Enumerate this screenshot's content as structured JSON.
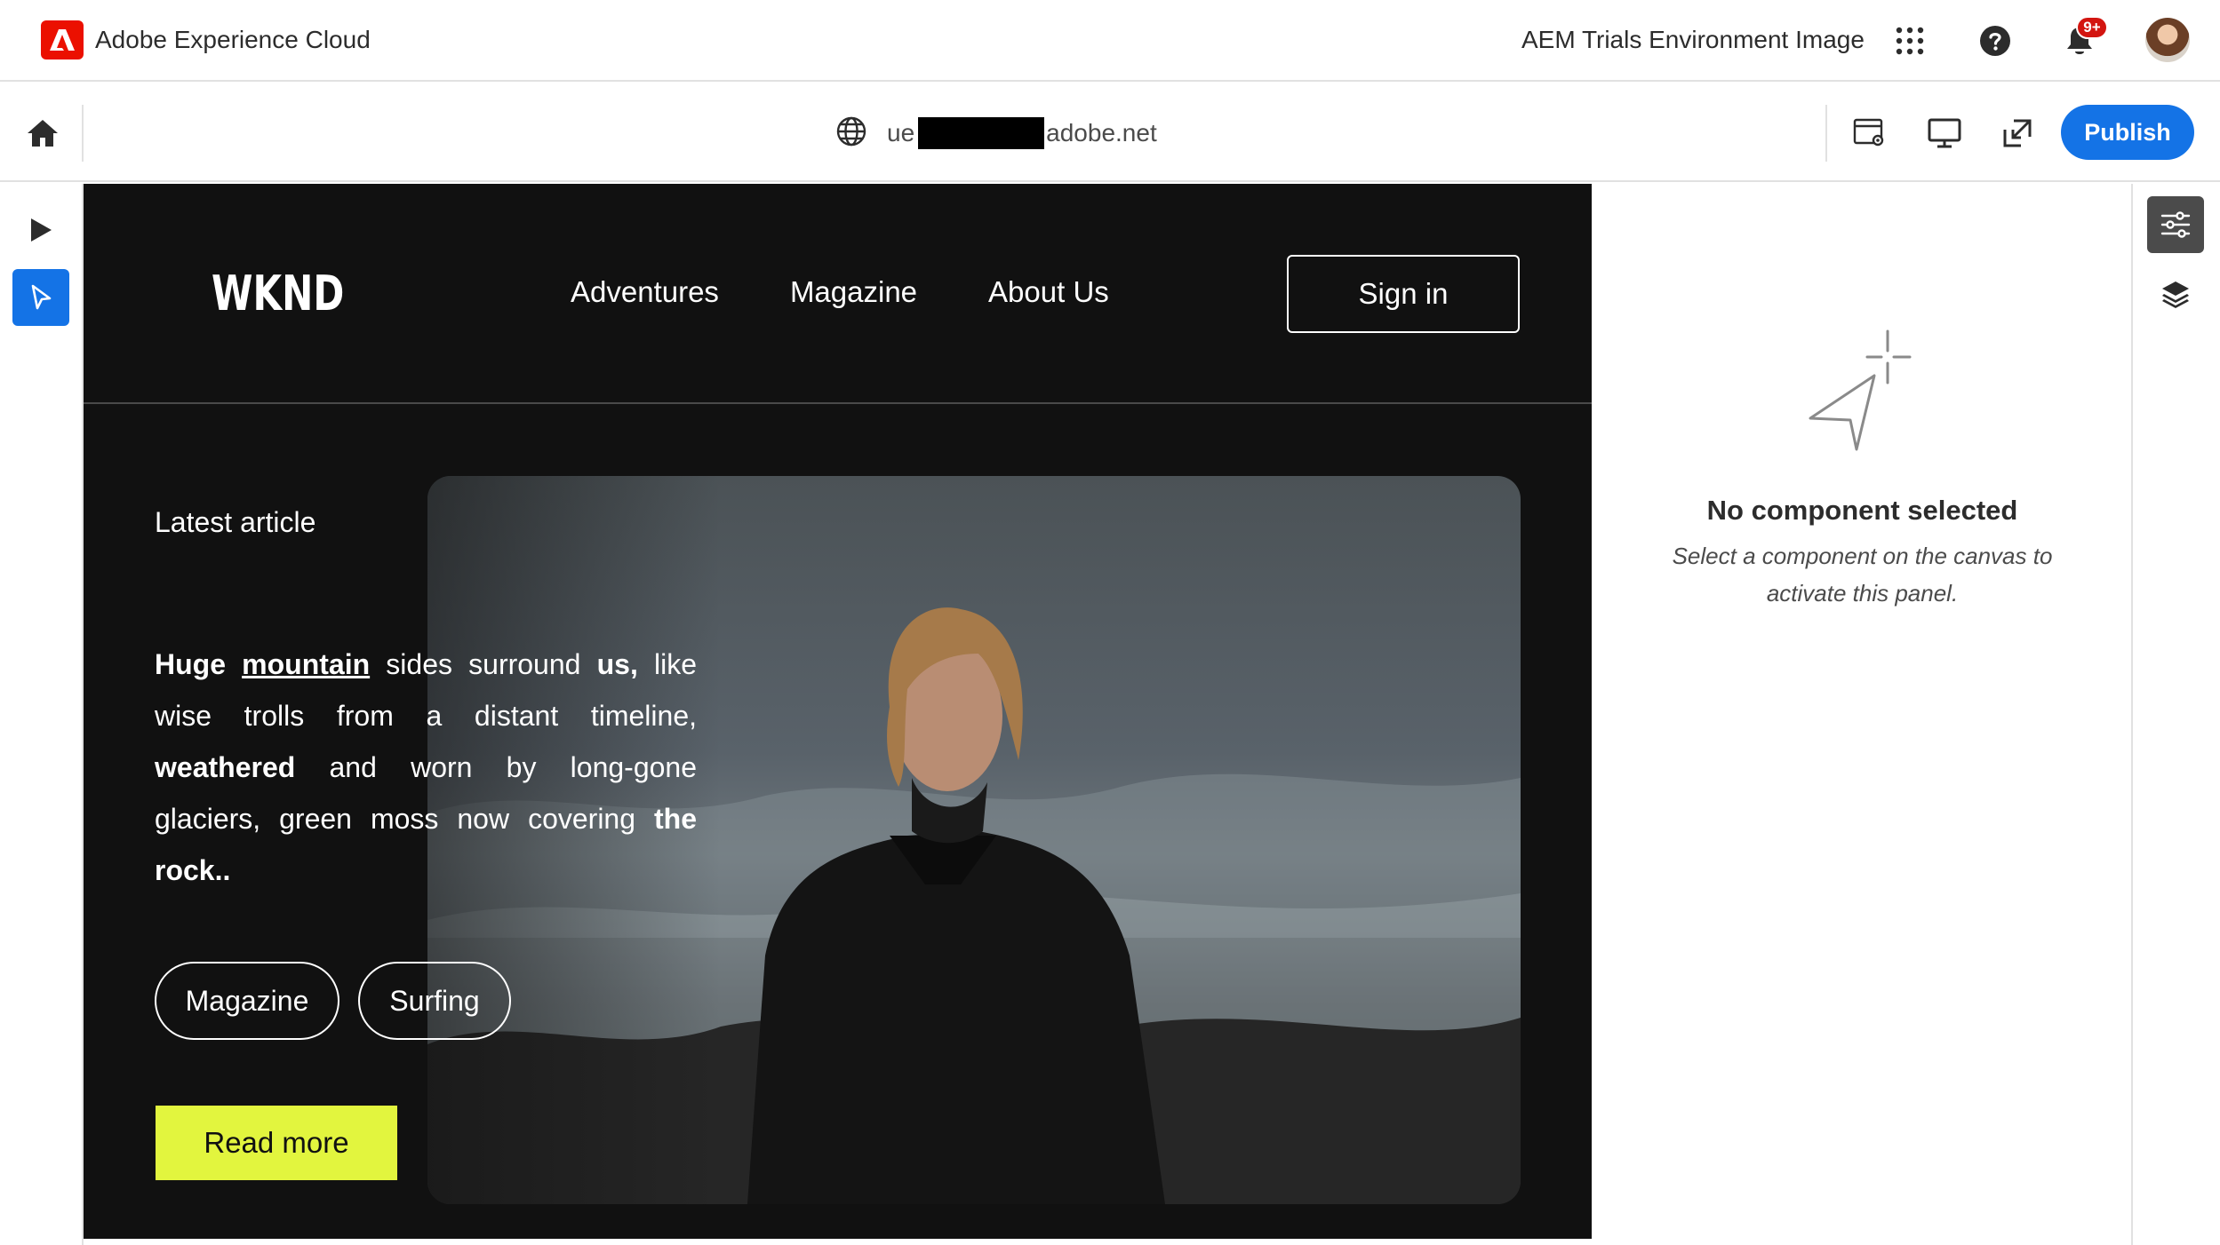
{
  "shell": {
    "brand_name": "Adobe Experience Cloud",
    "environment": "AEM Trials Environment Image",
    "notification_badge": "9+",
    "brand_color": "#eb1000",
    "icons": [
      "adobe-logo-icon",
      "apps-grid-icon",
      "help-icon",
      "bell-icon",
      "avatar"
    ]
  },
  "toolbar": {
    "url_prefix": "ue",
    "url_suffix": "adobe.net",
    "publish_label": "Publish",
    "accent": "#1473e6",
    "icons": [
      "home-icon",
      "globe-icon",
      "page-settings-icon",
      "desktop-icon",
      "open-external-icon"
    ]
  },
  "left_rail": {
    "icons": [
      "preview-play-icon",
      "select-pointer-icon"
    ],
    "active": "select-pointer-icon"
  },
  "site": {
    "logo": "WKND",
    "nav": [
      "Adventures",
      "Magazine",
      "About Us"
    ],
    "sign_in": "Sign in",
    "latest_label": "Latest article",
    "article": {
      "w1": "Huge",
      "w2": "mountain",
      "w3": "sides surround",
      "w4": "us,",
      "w5": "like wise trolls from a distant timeline,",
      "w6": "weathered",
      "w7": "and worn by long-gone glaciers, green moss now covering",
      "w8": "the rock.."
    },
    "tags": [
      "Magazine",
      "Surfing"
    ],
    "cta": "Read more",
    "cta_color": "#e2f53e"
  },
  "properties_panel": {
    "empty_title": "No component selected",
    "empty_description": "Select a component on the canvas to activate this panel."
  },
  "right_rail": {
    "icons": [
      "properties-sliders-icon",
      "layers-icon"
    ],
    "active": "properties-sliders-icon"
  }
}
